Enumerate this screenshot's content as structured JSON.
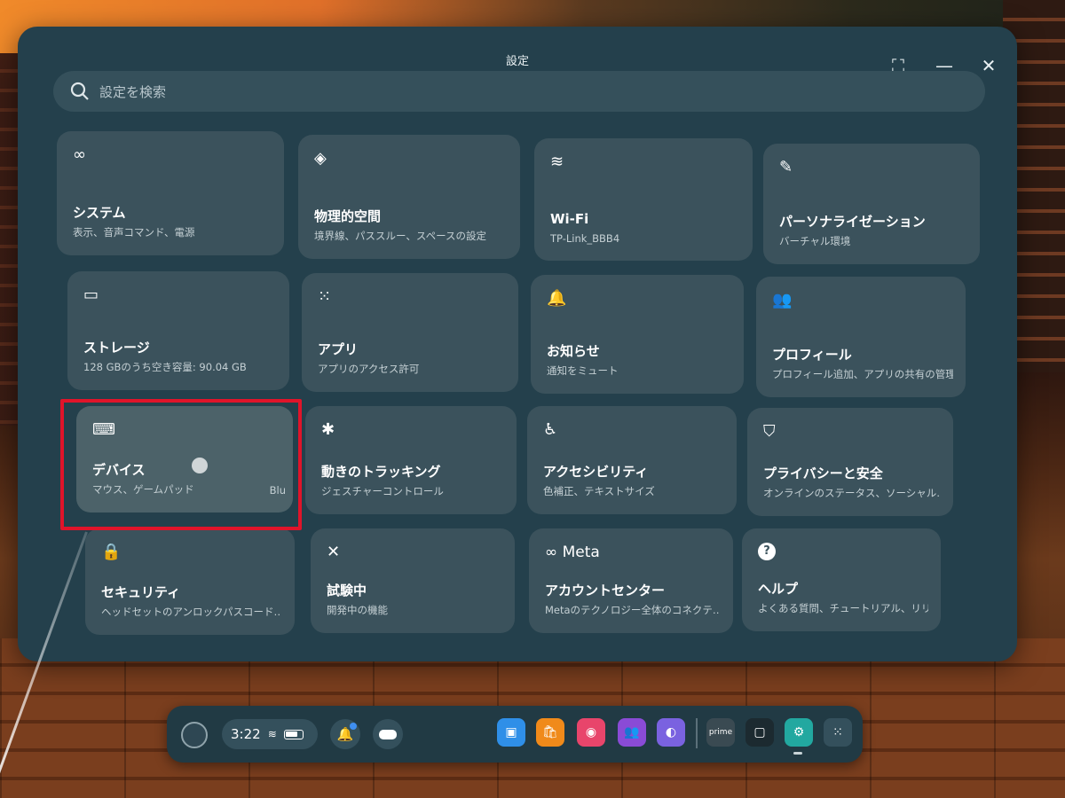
{
  "window": {
    "title": "設定",
    "expand_icon": "⛶",
    "minimize_icon": "—",
    "close_icon": "✕"
  },
  "search": {
    "placeholder": "設定を検索"
  },
  "tiles": [
    {
      "icon": "meta-icon",
      "glyph": "∞",
      "title": "システム",
      "subtitle": "表示、音声コマンド、電源"
    },
    {
      "icon": "physical-space-icon",
      "glyph": "◈",
      "title": "物理的空間",
      "subtitle": "境界線、パススルー、スペースの設定"
    },
    {
      "icon": "wifi-icon",
      "glyph": "≋",
      "title": "Wi-Fi",
      "subtitle": "TP-Link_BBB4"
    },
    {
      "icon": "pencil-icon",
      "glyph": "✎",
      "title": "パーソナライゼーション",
      "subtitle": "バーチャル環境"
    },
    {
      "icon": "storage-icon",
      "glyph": "▭",
      "title": "ストレージ",
      "subtitle": "128 GBのうち空き容量: 90.04 GB"
    },
    {
      "icon": "apps-grid-icon",
      "glyph": "⁙",
      "title": "アプリ",
      "subtitle": "アプリのアクセス許可"
    },
    {
      "icon": "bell-icon",
      "glyph": "🔔",
      "title": "お知らせ",
      "subtitle": "通知をミュート"
    },
    {
      "icon": "people-icon",
      "glyph": "👥",
      "title": "プロフィール",
      "subtitle": "プロフィール追加、アプリの共有の管理"
    },
    {
      "icon": "keyboard-icon",
      "glyph": "⌨",
      "title": "デバイス",
      "subtitle": "マウス、ゲームパッド",
      "extra": "Blu"
    },
    {
      "icon": "movement-tracking-icon",
      "glyph": "✱",
      "title": "動きのトラッキング",
      "subtitle": "ジェスチャーコントロール"
    },
    {
      "icon": "accessibility-icon",
      "glyph": "♿",
      "title": "アクセシビリティ",
      "subtitle": "色補正、テキストサイズ"
    },
    {
      "icon": "shield-icon",
      "glyph": "⛉",
      "title": "プライバシーと安全",
      "subtitle": "オンラインのステータス、ソーシャル‥"
    },
    {
      "icon": "lock-icon",
      "glyph": "🔒",
      "title": "セキュリティ",
      "subtitle": "ヘッドセットのアンロックパスコード‥"
    },
    {
      "icon": "experimental-icon",
      "glyph": "✕",
      "title": "試験中",
      "subtitle": "開発中の機能"
    },
    {
      "icon": "meta-logo-icon",
      "glyph": "∞ Meta",
      "title": "アカウントセンター",
      "subtitle": "Metaのテクノロジー全体のコネクテ‥"
    },
    {
      "icon": "help-icon",
      "glyph": "?",
      "title": "ヘルプ",
      "subtitle": "よくある質問、チュートリアル、リリ‥"
    }
  ],
  "taskbar": {
    "time": "3:22",
    "apps": [
      {
        "name": "store-app-icon",
        "color": "#2f8fe8",
        "glyph": "▣"
      },
      {
        "name": "shop-app-icon",
        "color": "#f08a1a",
        "glyph": "🛍"
      },
      {
        "name": "camera-app-icon",
        "color": "#e8456b",
        "glyph": "◉"
      },
      {
        "name": "people-app-icon",
        "color": "#8a4bd6",
        "glyph": "👥"
      },
      {
        "name": "horizon-app-icon",
        "color": "#7a62e0",
        "glyph": "◐"
      },
      {
        "name": "prime-video-app-icon",
        "color": "#3a4a52",
        "glyph": "prime"
      },
      {
        "name": "desktop-app-icon",
        "color": "#1c2a30",
        "glyph": "▢"
      },
      {
        "name": "settings-app-icon",
        "color": "#22a8a0",
        "glyph": "⚙"
      },
      {
        "name": "app-library-icon",
        "color": "#34505c",
        "glyph": "⁙"
      }
    ]
  }
}
